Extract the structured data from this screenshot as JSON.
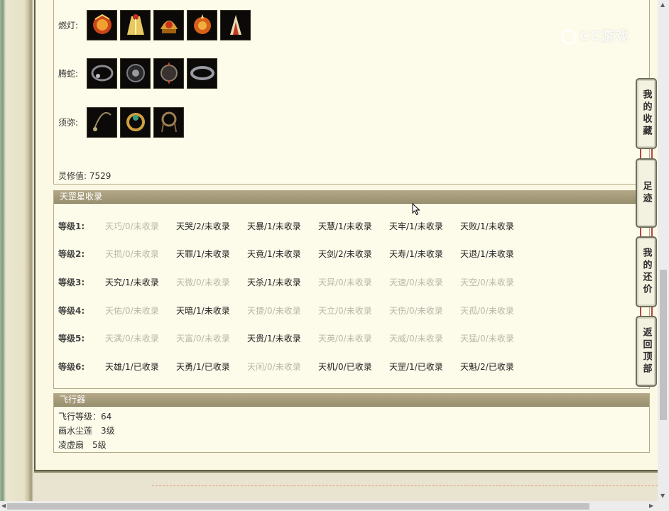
{
  "equipment": {
    "rows": [
      {
        "label": "燃灯:",
        "icons": [
          "fire-armor-icon",
          "golden-robe-icon",
          "golden-helm-icon",
          "flame-amulet-icon",
          "red-cloak-icon"
        ]
      },
      {
        "label": "腾蛇:",
        "icons": [
          "dark-necklace-icon",
          "dark-orb-icon",
          "spiked-orb-icon",
          "dark-bracelet-icon"
        ]
      },
      {
        "label": "须弥:",
        "icons": [
          "chain-necklace-icon",
          "emerald-ring-icon",
          "bead-bracelet-icon"
        ]
      }
    ],
    "spirit_label": "灵修值:",
    "spirit_value": "7529"
  },
  "tiangang": {
    "title": "天罡星收录",
    "rows": [
      {
        "level": "等级1:",
        "entries": [
          {
            "text": "天巧/0/未收录",
            "dim": true
          },
          {
            "text": "天哭/2/未收录",
            "dim": false
          },
          {
            "text": "天暴/1/未收录",
            "dim": false
          },
          {
            "text": "天慧/1/未收录",
            "dim": false
          },
          {
            "text": "天牢/1/未收录",
            "dim": false
          },
          {
            "text": "天败/1/未收录",
            "dim": false
          }
        ]
      },
      {
        "level": "等级2:",
        "entries": [
          {
            "text": "天损/0/未收录",
            "dim": true
          },
          {
            "text": "天罪/1/未收录",
            "dim": false
          },
          {
            "text": "天竟/1/未收录",
            "dim": false
          },
          {
            "text": "天剑/2/未收录",
            "dim": false
          },
          {
            "text": "天寿/1/未收录",
            "dim": false
          },
          {
            "text": "天退/1/未收录",
            "dim": false
          }
        ]
      },
      {
        "level": "等级3:",
        "entries": [
          {
            "text": "天究/1/未收录",
            "dim": false
          },
          {
            "text": "天微/0/未收录",
            "dim": true
          },
          {
            "text": "天杀/1/未收录",
            "dim": false
          },
          {
            "text": "天异/0/未收录",
            "dim": true
          },
          {
            "text": "天速/0/未收录",
            "dim": true
          },
          {
            "text": "天空/0/未收录",
            "dim": true
          }
        ]
      },
      {
        "level": "等级4:",
        "entries": [
          {
            "text": "天佑/0/未收录",
            "dim": true
          },
          {
            "text": "天暗/1/未收录",
            "dim": false
          },
          {
            "text": "天捷/0/未收录",
            "dim": true
          },
          {
            "text": "天立/0/未收录",
            "dim": true
          },
          {
            "text": "天伤/0/未收录",
            "dim": true
          },
          {
            "text": "天孤/0/未收录",
            "dim": true
          }
        ]
      },
      {
        "level": "等级5:",
        "entries": [
          {
            "text": "天满/0/未收录",
            "dim": true
          },
          {
            "text": "天富/0/未收录",
            "dim": true
          },
          {
            "text": "天贵/1/未收录",
            "dim": false
          },
          {
            "text": "天英/0/未收录",
            "dim": true
          },
          {
            "text": "天威/0/未收录",
            "dim": true
          },
          {
            "text": "天猛/0/未收录",
            "dim": true
          }
        ]
      },
      {
        "level": "等级6:",
        "entries": [
          {
            "text": "天雄/1/已收录",
            "dim": false
          },
          {
            "text": "天勇/1/已收录",
            "dim": false
          },
          {
            "text": "天闲/0/未收录",
            "dim": true
          },
          {
            "text": "天机/0/已收录",
            "dim": false
          },
          {
            "text": "天罡/1/已收录",
            "dim": false
          },
          {
            "text": "天魁/2/已收录",
            "dim": false
          }
        ]
      }
    ]
  },
  "flyer": {
    "title": "飞行器",
    "lines": [
      "飞行等级：64",
      "画水尘莲　3级",
      "凌虚扇　5级"
    ]
  },
  "side_buttons": [
    "我的收藏",
    "足迹",
    "我的还价",
    "返回顶部"
  ],
  "watermark": "CC游戏",
  "colors": {
    "header_bg": "#a89d7c",
    "panel_bg": "#fbf8e4",
    "dim_text": "#b9b7a9",
    "link_red": "#b44545"
  }
}
